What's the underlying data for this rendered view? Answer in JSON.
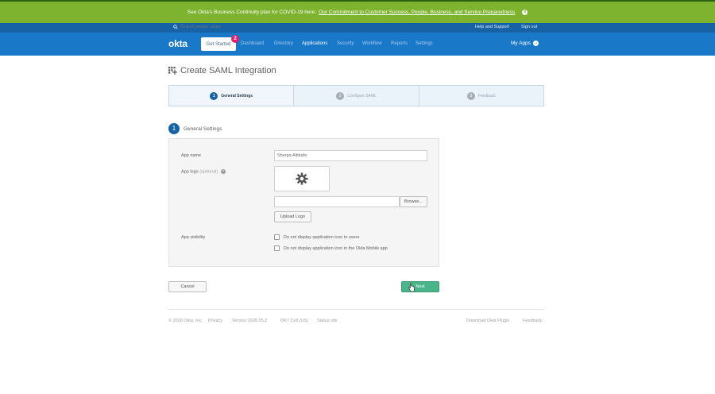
{
  "banner": {
    "text": "See Okta's Business Continuity plan for COVID-19 here:",
    "link": "Our Commitment to Customer Success, People, Business, and Service Preparedness",
    "close_icon": "x"
  },
  "utility": {
    "search_placeholder": "Search people, apps",
    "help": "Help and Support",
    "signout": "Sign out"
  },
  "nav": {
    "logo": "okta",
    "get_started": "Get Started",
    "badge": "2",
    "items": [
      "Dashboard",
      "Directory",
      "Applications",
      "Security",
      "Workflow",
      "Reports",
      "Settings"
    ],
    "active": "Applications",
    "my_apps": "My Apps",
    "my_apps_icon": "→"
  },
  "page": {
    "title": "Create SAML Integration"
  },
  "steps": [
    {
      "num": "1",
      "label": "General Settings"
    },
    {
      "num": "2",
      "label": "Configure SAML"
    },
    {
      "num": "3",
      "label": "Feedback"
    }
  ],
  "section": {
    "num": "1",
    "title": "General Settings"
  },
  "form": {
    "app_name_label": "App name",
    "app_name_value": "Sherpa Altitude",
    "app_logo_label": "App logo",
    "app_logo_optional": "(optional)",
    "help_icon": "?",
    "browse": "Browse...",
    "upload_logo": "Upload Logo",
    "visibility_label": "App visibility",
    "check1": "Do not display application icon to users",
    "check2": "Do not display application icon in the Okta Mobile app"
  },
  "actions": {
    "cancel": "Cancel",
    "next": "Next"
  },
  "footer": {
    "copyright": "© 2020 Okta, Inc.",
    "privacy": "Privacy",
    "version": "Version 2020.05.2",
    "cell": "OK7 Cell (US)",
    "status": "Status site",
    "download": "Download Okta Plugin",
    "feedback": "Feedback"
  },
  "colors": {
    "banner": "#7db32f",
    "nav": "#1a78c8",
    "utility": "#1662a4",
    "accent": "#1662a4",
    "next": "#4ab58a",
    "badge": "#e0246b"
  }
}
